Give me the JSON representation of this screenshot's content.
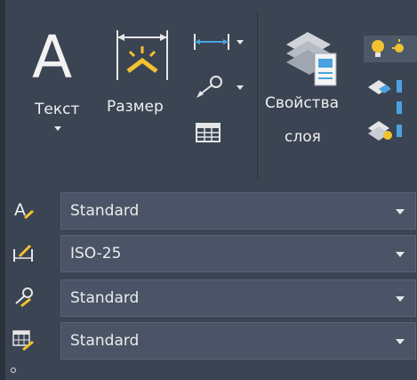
{
  "ribbon": {
    "text_button": {
      "label": "Текст"
    },
    "dimension_button": {
      "label": "Размер"
    },
    "layer_properties_button": {
      "label_line1": "Свойства",
      "label_line2": "слоя"
    }
  },
  "style_rows": [
    {
      "icon": "text-style-icon",
      "value": "Standard"
    },
    {
      "icon": "dimension-style-icon",
      "value": "ISO-25"
    },
    {
      "icon": "multileader-style-icon",
      "value": "Standard"
    },
    {
      "icon": "table-style-icon",
      "value": "Standard"
    }
  ],
  "colors": {
    "panel_bg": "#3b4453",
    "combo_bg": "#4a5466",
    "accent_blue": "#4aa3e0",
    "accent_yellow": "#f2c230",
    "text": "#ececec"
  }
}
